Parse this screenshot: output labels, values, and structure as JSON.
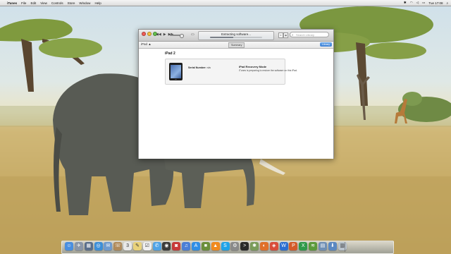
{
  "menubar": {
    "apple_glyph": "",
    "items": [
      "iTunes",
      "File",
      "Edit",
      "View",
      "Controls",
      "Store",
      "Window",
      "Help"
    ],
    "clock": "Tue 17:08",
    "status_icons": [
      "bluetooth-icon",
      "wifi-icon",
      "volume-icon",
      "battery-icon",
      "search-icon"
    ]
  },
  "window": {
    "lcd_status": "Extracting software...",
    "extract_progress": 0.45,
    "search_placeholder": "Search Library",
    "device_label": "iPad",
    "tabs": [
      "Summary"
    ],
    "library_button": "Library",
    "page_title": "iPad 2",
    "serial_label": "Serial Number:",
    "serial_value": "n/a",
    "recovery_title": "iPad Recovery Mode",
    "recovery_desc": "iTunes is preparing to restore the software on this iPad."
  },
  "dock": {
    "icons": [
      {
        "name": "finder-icon",
        "glyph": "☺",
        "color": "#4a8fe0"
      },
      {
        "name": "launchpad-icon",
        "glyph": "✈",
        "color": "#8a96a8"
      },
      {
        "name": "mission-control-icon",
        "glyph": "▦",
        "color": "#5a6f8c"
      },
      {
        "name": "safari-icon",
        "glyph": "◎",
        "color": "#3d8fd8"
      },
      {
        "name": "mail-icon",
        "glyph": "✉",
        "color": "#6f9bcf"
      },
      {
        "name": "contacts-icon",
        "glyph": "☏",
        "color": "#b08a5a"
      },
      {
        "name": "calendar-icon",
        "glyph": "3",
        "color": "#e8e8e8"
      },
      {
        "name": "notes-icon",
        "glyph": "✎",
        "color": "#e9d27a"
      },
      {
        "name": "reminders-icon",
        "glyph": "☑",
        "color": "#f0f0f0"
      },
      {
        "name": "messages-icon",
        "glyph": "✆",
        "color": "#4fa3e6"
      },
      {
        "name": "facetime-icon",
        "glyph": "◉",
        "color": "#3b3b3b"
      },
      {
        "name": "photo-booth-icon",
        "glyph": "◙",
        "color": "#c73a3a"
      },
      {
        "name": "itunes-icon",
        "glyph": "♫",
        "color": "#4b7fd6"
      },
      {
        "name": "app-store-icon",
        "glyph": "A",
        "color": "#2f8ee6"
      },
      {
        "name": "minecraft-icon",
        "glyph": "■",
        "color": "#6b8f3a"
      },
      {
        "name": "vlc-icon",
        "glyph": "▲",
        "color": "#f08a1f"
      },
      {
        "name": "skype-icon",
        "glyph": "S",
        "color": "#1fa3e8"
      },
      {
        "name": "system-preferences-icon",
        "glyph": "⚙",
        "color": "#8a8a8a"
      },
      {
        "name": "terminal-icon",
        "glyph": ">",
        "color": "#2a2a2a"
      },
      {
        "name": "activity-monitor-icon",
        "glyph": "✱",
        "color": "#7a9c5a"
      },
      {
        "name": "firefox-icon",
        "glyph": "◐",
        "color": "#e0702a"
      },
      {
        "name": "flip-icon",
        "glyph": "◈",
        "color": "#d94c3a"
      },
      {
        "name": "word-icon",
        "glyph": "W",
        "color": "#2d6fd1"
      },
      {
        "name": "powerpoint-icon",
        "glyph": "P",
        "color": "#d45a2a"
      },
      {
        "name": "excel-icon",
        "glyph": "X",
        "color": "#2f9a4a"
      },
      {
        "name": "spotify-icon",
        "glyph": "≋",
        "color": "#5a9a3a"
      },
      {
        "name": "documents-icon",
        "glyph": "▤",
        "color": "#6f8fb5"
      },
      {
        "name": "downloads-icon",
        "glyph": "⬇",
        "color": "#5a88c2"
      },
      {
        "name": "trash-icon",
        "glyph": "▥",
        "color": "#b9c3cc"
      }
    ]
  }
}
